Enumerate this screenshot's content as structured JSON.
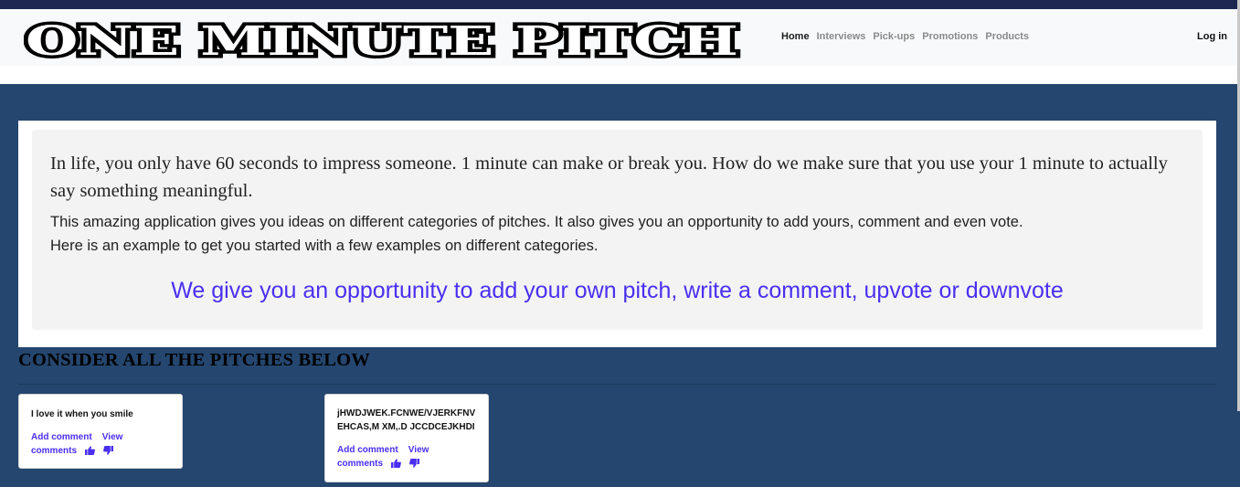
{
  "brand": {
    "logo_text": "ONE MINUTE PITCH"
  },
  "nav": {
    "links": [
      {
        "label": "Home"
      },
      {
        "label": "Interviews"
      },
      {
        "label": "Pick-ups"
      },
      {
        "label": "Promotions"
      },
      {
        "label": "Products"
      }
    ],
    "login_label": "Log in"
  },
  "jumbotron": {
    "lead": "In life, you only have 60 seconds to impress someone. 1 minute can make or break you. How do we make sure that you use your 1 minute to actually say something meaningful.",
    "desc_line1": "This amazing application gives you ideas on different categories of pitches. It also gives you an opportunity to add yours, comment and even vote.",
    "desc_line2": "Here is an example to get you started with a few examples on different categories.",
    "cta": "We give you an opportunity to add your own pitch, write a comment, upvote or downvote"
  },
  "pitches": {
    "section_title": "CONSIDER ALL THE PITCHES BELOW",
    "items": [
      {
        "text": "I love it when you smile",
        "add_comment": "Add comment",
        "view_comments": "View comments"
      },
      {
        "text": "jHWDJWEK.FCNWE/VJERKFNVEHCAS,M XM,.D JCCDCEJKHDI",
        "add_comment": "Add comment",
        "view_comments": "View comments"
      }
    ]
  },
  "colors": {
    "header_strip": "#1d2752",
    "page_bg": "#24466f",
    "accent": "#4a2ff0"
  },
  "icons": [
    "thumbs-up-icon",
    "thumbs-down-icon"
  ]
}
